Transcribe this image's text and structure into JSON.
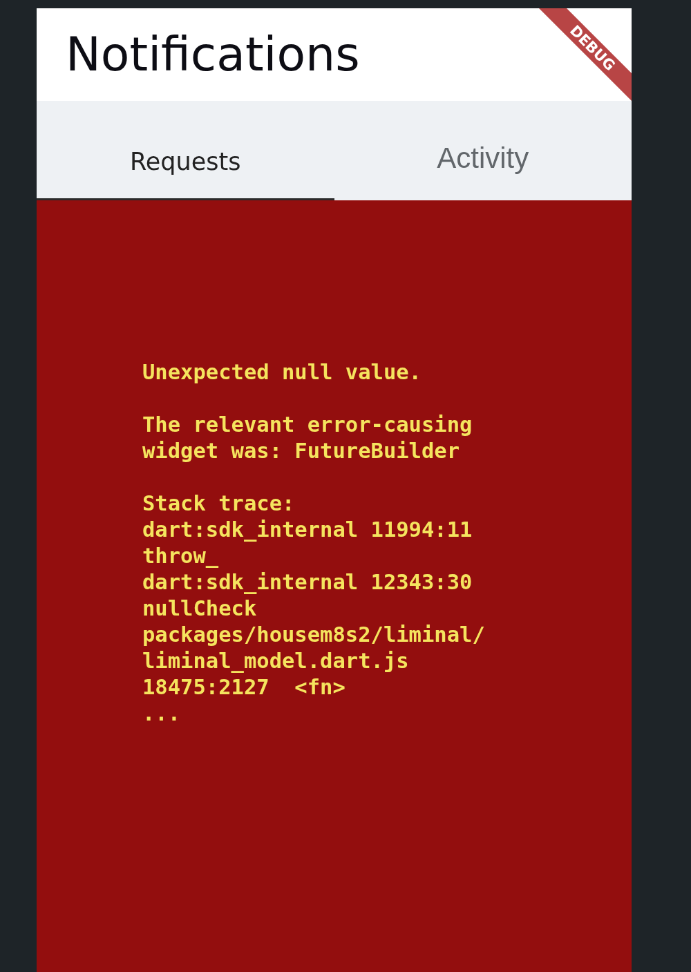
{
  "app_bar": {
    "title": "Notifications"
  },
  "debug_banner": {
    "label": "DEBUG"
  },
  "tabs": [
    {
      "label": "Requests",
      "selected": true
    },
    {
      "label": "Activity",
      "selected": false
    }
  ],
  "error": {
    "paragraphs": [
      [
        "Unexpected null value."
      ],
      [
        "The relevant error-causing",
        "widget was: FutureBuilder"
      ],
      [
        "Stack trace:",
        "dart:sdk_internal 11994:11",
        "throw_",
        "dart:sdk_internal 12343:30",
        "nullCheck",
        "packages/housem8s2/liminal/",
        "liminal_model.dart.js",
        "18475:2127  <fn>",
        "..."
      ]
    ]
  }
}
